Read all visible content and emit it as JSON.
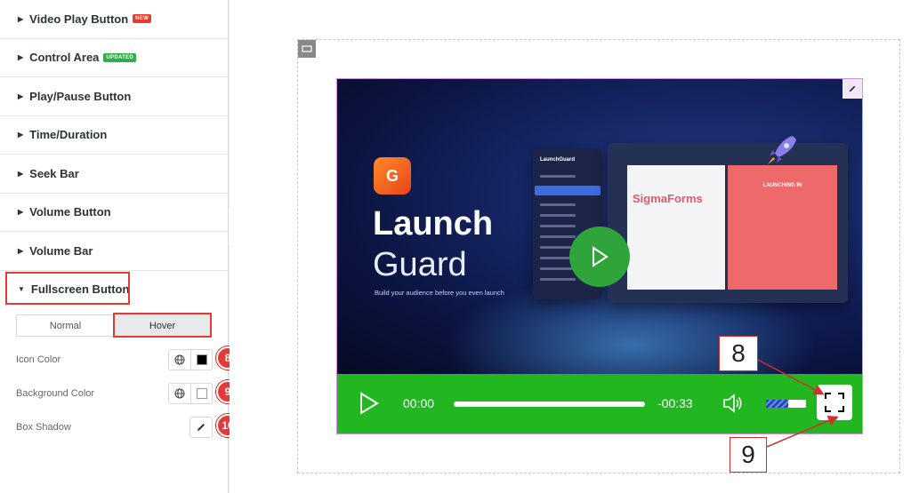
{
  "panel": {
    "sections": [
      {
        "label": "Video Play Button",
        "badge": "NEW"
      },
      {
        "label": "Control Area",
        "badge": "UPDATED"
      },
      {
        "label": "Play/Pause Button"
      },
      {
        "label": "Time/Duration"
      },
      {
        "label": "Seek Bar"
      },
      {
        "label": "Volume Button"
      },
      {
        "label": "Volume Bar"
      }
    ],
    "open_section": "Fullscreen Button",
    "tabs": [
      "Normal",
      "Hover"
    ],
    "active_tab": "Hover",
    "controls": [
      {
        "label": "Icon Color",
        "swatch": "#000000",
        "marker": "8"
      },
      {
        "label": "Background Color",
        "swatch": "#ffffff",
        "marker": "9"
      },
      {
        "label": "Box Shadow",
        "marker": "10"
      }
    ]
  },
  "video": {
    "brand_line1": "Launch",
    "brand_line2": "Guard",
    "tagline": "Build your audience before you even launch",
    "mock_title": "SigmaForms",
    "mock_launch": "LAUNCHING IN",
    "mock_app": "LaunchGuard"
  },
  "player": {
    "current_time": "00:00",
    "remaining_time": "-00:33",
    "volume_level": 0.55
  },
  "annotations": {
    "callout_8": "8",
    "callout_9": "9"
  },
  "colors": {
    "control_bar": "#22b621",
    "highlight": "#e53935"
  }
}
